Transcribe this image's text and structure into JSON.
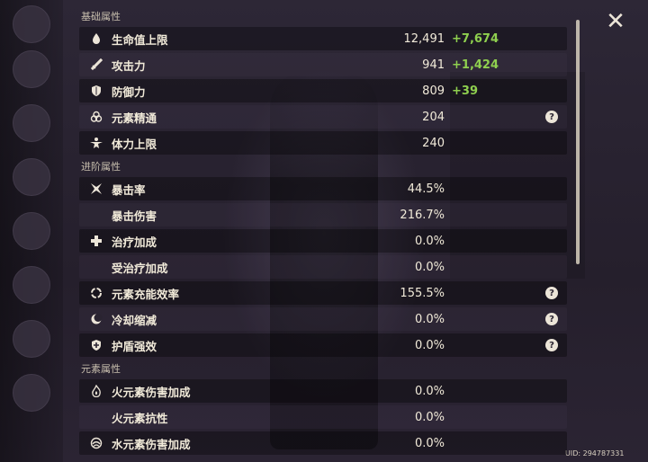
{
  "ui": {
    "close_label": "✕",
    "uid": "UID: 294787331",
    "help_glyph": "?"
  },
  "sections": [
    {
      "title": "基础属性"
    },
    {
      "title": "进阶属性"
    },
    {
      "title": "元素属性"
    }
  ],
  "base": [
    {
      "label": "生命值上限",
      "value": "12,491",
      "bonus": "+7,674",
      "icon": "hp-droplet-icon"
    },
    {
      "label": "攻击力",
      "value": "941",
      "bonus": "+1,424",
      "icon": "sword-icon"
    },
    {
      "label": "防御力",
      "value": "809",
      "bonus": "+39",
      "icon": "shield-icon"
    },
    {
      "label": "元素精通",
      "value": "204",
      "bonus": "",
      "icon": "mastery-icon",
      "help": true
    },
    {
      "label": "体力上限",
      "value": "240",
      "bonus": "",
      "icon": "stamina-icon"
    }
  ],
  "advanced": [
    {
      "label": "暴击率",
      "value": "44.5%",
      "icon": "crit-star-icon"
    },
    {
      "label": "暴击伤害",
      "value": "216.7%",
      "icon": ""
    },
    {
      "label": "治疗加成",
      "value": "0.0%",
      "icon": "healing-cross-icon"
    },
    {
      "label": "受治疗加成",
      "value": "0.0%",
      "icon": ""
    },
    {
      "label": "元素充能效率",
      "value": "155.5%",
      "icon": "energy-recharge-icon",
      "help": true
    },
    {
      "label": "冷却缩减",
      "value": "0.0%",
      "icon": "cooldown-icon",
      "help": true
    },
    {
      "label": "护盾强效",
      "value": "0.0%",
      "icon": "shield-strength-icon",
      "help": true
    }
  ],
  "elemental": [
    {
      "label": "火元素伤害加成",
      "value": "0.0%",
      "icon": "pyro-icon"
    },
    {
      "label": "火元素抗性",
      "value": "0.0%",
      "icon": ""
    },
    {
      "label": "水元素伤害加成",
      "value": "0.0%",
      "icon": "hydro-icon"
    }
  ]
}
